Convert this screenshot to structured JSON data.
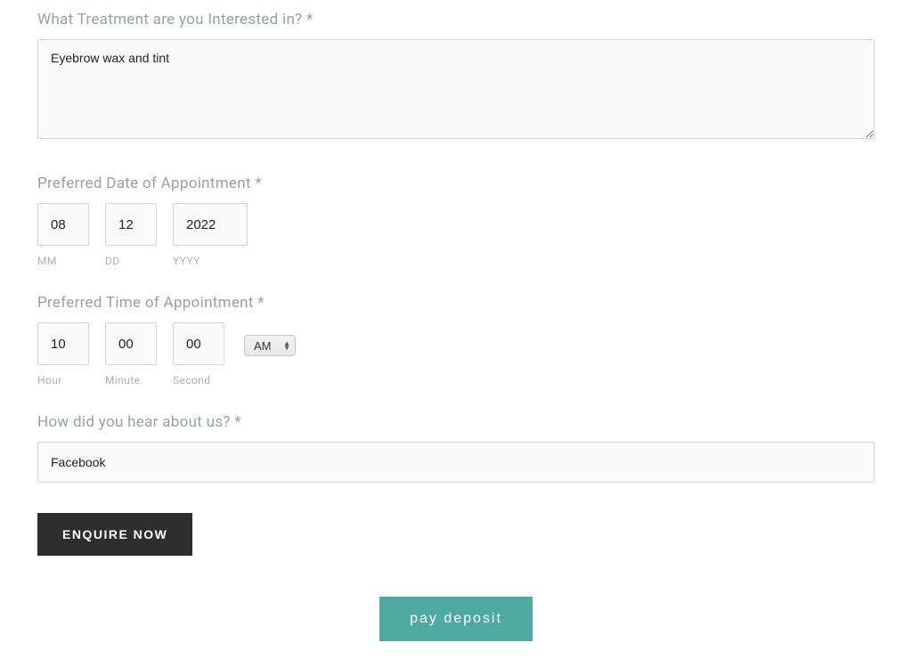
{
  "treatment": {
    "label": "What Treatment are you Interested in? *",
    "value": "Eyebrow wax and tint"
  },
  "date": {
    "label": "Preferred Date of Appointment *",
    "mm": {
      "value": "08",
      "sublabel": "MM"
    },
    "dd": {
      "value": "12",
      "sublabel": "DD"
    },
    "yyyy": {
      "value": "2022",
      "sublabel": "YYYY"
    }
  },
  "time": {
    "label": "Preferred Time of Appointment *",
    "hour": {
      "value": "10",
      "sublabel": "Hour"
    },
    "minute": {
      "value": "00",
      "sublabel": "Minute"
    },
    "second": {
      "value": "00",
      "sublabel": "Second"
    },
    "ampm": "AM"
  },
  "hear": {
    "label": "How did you hear about us? *",
    "value": "Facebook"
  },
  "buttons": {
    "enquire": "ENQUIRE NOW",
    "pay_deposit": "pay deposit"
  }
}
